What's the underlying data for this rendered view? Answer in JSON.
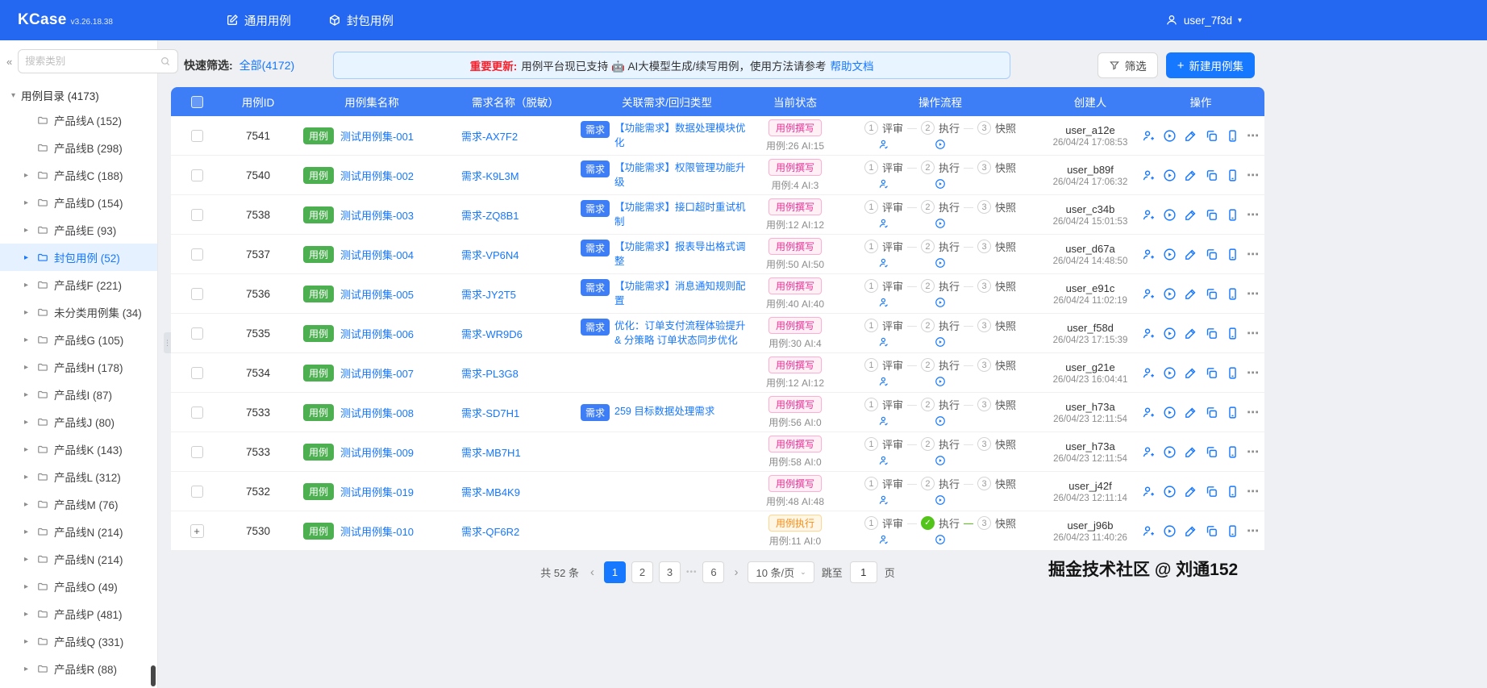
{
  "navbar": {
    "logo": "KCase",
    "version": "v3.26.18.38",
    "tabs": [
      {
        "label": "通用用例"
      },
      {
        "label": "封包用例"
      }
    ],
    "user": "user_7f3d"
  },
  "sidebar": {
    "search_placeholder": "搜索类别",
    "root_label": "用例目录 (4173)",
    "items": [
      {
        "label": "产品线A",
        "count": "(152)",
        "caret": false
      },
      {
        "label": "产品线B",
        "count": "(298)",
        "caret": false
      },
      {
        "label": "产品线C",
        "count": "(188)",
        "caret": true
      },
      {
        "label": "产品线D",
        "count": "(154)",
        "caret": true
      },
      {
        "label": "产品线E",
        "count": "(93)",
        "caret": true
      },
      {
        "label": "封包用例",
        "count": "(52)",
        "caret": true,
        "selected": true
      },
      {
        "label": "产品线F",
        "count": "(221)",
        "caret": true
      },
      {
        "label": "未分类用例集",
        "count": "(34)",
        "caret": true
      },
      {
        "label": "产品线G",
        "count": "(105)",
        "caret": true
      },
      {
        "label": "产品线H",
        "count": "(178)",
        "caret": true
      },
      {
        "label": "产品线I",
        "count": "(87)",
        "caret": true
      },
      {
        "label": "产品线J",
        "count": "(80)",
        "caret": true
      },
      {
        "label": "产品线K",
        "count": "(143)",
        "caret": true
      },
      {
        "label": "产品线L",
        "count": "(312)",
        "caret": true
      },
      {
        "label": "产品线M",
        "count": "(76)",
        "caret": true
      },
      {
        "label": "产品线N",
        "count": "(214)",
        "caret": true
      },
      {
        "label": "产品线N",
        "count": "(214)",
        "caret": true
      },
      {
        "label": "产品线O",
        "count": "(49)",
        "caret": true
      },
      {
        "label": "产品线P",
        "count": "(481)",
        "caret": true
      },
      {
        "label": "产品线Q",
        "count": "(331)",
        "caret": true
      },
      {
        "label": "产品线R",
        "count": "(88)",
        "caret": true
      }
    ]
  },
  "toolbar": {
    "quick_filter_label": "快速筛选:",
    "quick_filter_value": "全部(4172)",
    "banner_highlight": "重要更新:",
    "banner_text": "用例平台现已支持 🤖 AI大模型生成/续写用例，使用方法请参考",
    "banner_link": "帮助文档",
    "filter_button": "筛选",
    "new_button": "新建用例集"
  },
  "table": {
    "headers": [
      "用例ID",
      "用例集名称",
      "需求名称（脱敏）",
      "关联需求/回归类型",
      "当前状态",
      "操作流程",
      "创建人",
      "操作"
    ],
    "case_tag": "用例",
    "flow_labels": [
      "评审",
      "执行",
      "快照"
    ],
    "flow_numbers": [
      "1",
      "2",
      "3"
    ],
    "rows": [
      {
        "id": "7541",
        "name": "测试用例集-001",
        "req": "需求-AX7F2",
        "rel": {
          "tag": "需求",
          "text": "【功能需求】数据处理模块优化"
        },
        "status": {
          "label": "用例撰写",
          "type": "pink",
          "sub": "用例:26 AI:15"
        },
        "done2": false,
        "expand": false,
        "creator": {
          "name": "user_a12e",
          "date": "26/04/24 17:08:53"
        }
      },
      {
        "id": "7540",
        "name": "测试用例集-002",
        "req": "需求-K9L3M",
        "rel": {
          "tag": "需求",
          "text": "【功能需求】权限管理功能升级"
        },
        "status": {
          "label": "用例撰写",
          "type": "pink",
          "sub": "用例:4 AI:3"
        },
        "done2": false,
        "expand": false,
        "creator": {
          "name": "user_b89f",
          "date": "26/04/24 17:06:32"
        }
      },
      {
        "id": "7538",
        "name": "测试用例集-003",
        "req": "需求-ZQ8B1",
        "rel": {
          "tag": "需求",
          "text": "【功能需求】接口超时重试机制"
        },
        "status": {
          "label": "用例撰写",
          "type": "pink",
          "sub": "用例:12 AI:12"
        },
        "done2": false,
        "expand": false,
        "creator": {
          "name": "user_c34b",
          "date": "26/04/24 15:01:53"
        }
      },
      {
        "id": "7537",
        "name": "测试用例集-004",
        "req": "需求-VP6N4",
        "rel": {
          "tag": "需求",
          "text": "【功能需求】报表导出格式调整"
        },
        "status": {
          "label": "用例撰写",
          "type": "pink",
          "sub": "用例:50 AI:50"
        },
        "done2": false,
        "expand": false,
        "creator": {
          "name": "user_d67a",
          "date": "26/04/24 14:48:50"
        }
      },
      {
        "id": "7536",
        "name": "测试用例集-005",
        "req": "需求-JY2T5",
        "rel": {
          "tag": "需求",
          "text": "【功能需求】消息通知规则配置"
        },
        "status": {
          "label": "用例撰写",
          "type": "pink",
          "sub": "用例:40 AI:40"
        },
        "done2": false,
        "expand": false,
        "creator": {
          "name": "user_e91c",
          "date": "26/04/24 11:02:19"
        }
      },
      {
        "id": "7535",
        "name": "测试用例集-006",
        "req": "需求-WR9D6",
        "rel": {
          "tag": "需求",
          "text": "优化：订单支付流程体验提升 & 分策略 订单状态同步优化"
        },
        "status": {
          "label": "用例撰写",
          "type": "pink",
          "sub": "用例:30 AI:4"
        },
        "done2": false,
        "expand": false,
        "creator": {
          "name": "user_f58d",
          "date": "26/04/23 17:15:39"
        }
      },
      {
        "id": "7534",
        "name": "测试用例集-007",
        "req": "需求-PL3G8",
        "rel": null,
        "status": {
          "label": "用例撰写",
          "type": "pink",
          "sub": "用例:12 AI:12"
        },
        "done2": false,
        "expand": false,
        "creator": {
          "name": "user_g21e",
          "date": "26/04/23 16:04:41"
        }
      },
      {
        "id": "7533",
        "name": "测试用例集-008",
        "req": "需求-SD7H1",
        "rel": {
          "tag": "需求",
          "text": "259 目标数据处理需求"
        },
        "status": {
          "label": "用例撰写",
          "type": "pink",
          "sub": "用例:56 AI:0"
        },
        "done2": false,
        "expand": false,
        "creator": {
          "name": "user_h73a",
          "date": "26/04/23 12:11:54"
        }
      },
      {
        "id": "7533",
        "name": "测试用例集-009",
        "req": "需求-MB7H1",
        "rel": null,
        "status": {
          "label": "用例撰写",
          "type": "pink",
          "sub": "用例:58 AI:0"
        },
        "done2": false,
        "expand": false,
        "creator": {
          "name": "user_h73a",
          "date": "26/04/23 12:11:54"
        }
      },
      {
        "id": "7532",
        "name": "测试用例集-019",
        "req": "需求-MB4K9",
        "rel": null,
        "status": {
          "label": "用例撰写",
          "type": "pink",
          "sub": "用例:48 AI:48"
        },
        "done2": false,
        "expand": false,
        "creator": {
          "name": "user_j42f",
          "date": "26/04/23 12:11:14"
        }
      },
      {
        "id": "7530",
        "name": "测试用例集-010",
        "req": "需求-QF6R2",
        "rel": null,
        "status": {
          "label": "用例执行",
          "type": "orange",
          "sub": "用例:11 AI:0"
        },
        "done2": true,
        "expand": true,
        "creator": {
          "name": "user_j96b",
          "date": "26/04/23 11:40:26"
        }
      }
    ]
  },
  "pagination": {
    "total": "共 52 条",
    "pages": [
      "1",
      "2",
      "3",
      "...",
      "6"
    ],
    "active": "1",
    "page_size": "10 条/页",
    "jump_label": "跳至",
    "jump_value": "1",
    "jump_suffix": "页"
  },
  "watermark": "掘金技术社区 @ 刘通152"
}
